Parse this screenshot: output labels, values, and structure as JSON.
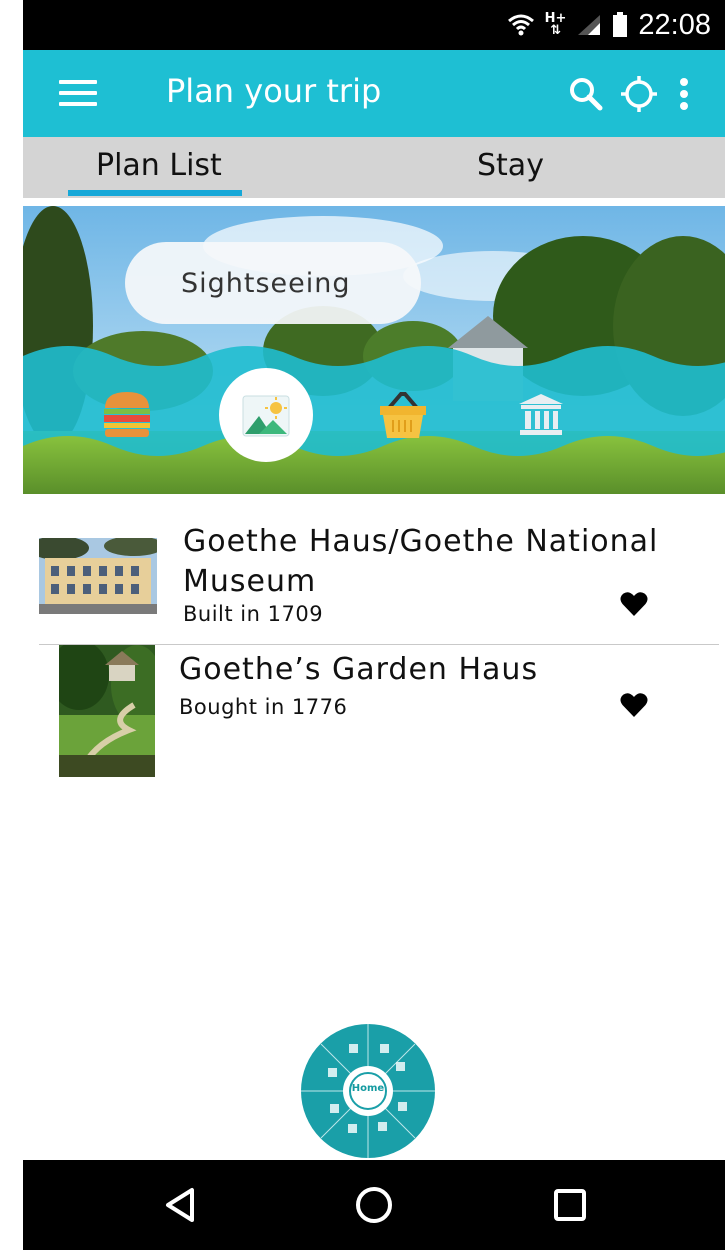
{
  "status_bar": {
    "time": "22:08",
    "network_type": "H+",
    "icons": [
      "wifi-icon",
      "signal-icon",
      "battery-icon"
    ]
  },
  "app_bar": {
    "title": "Plan your trip",
    "icons": [
      "menu-icon",
      "search-icon",
      "location-crosshair-icon",
      "more-vert-icon"
    ],
    "color": "#1ebfd3"
  },
  "tabs": [
    {
      "label": "Plan List",
      "active": true
    },
    {
      "label": "Stay",
      "active": false
    }
  ],
  "banner": {
    "selected_category": "Sightseeing",
    "categories": [
      {
        "icon": "burger-icon",
        "selected": false
      },
      {
        "icon": "landscape-picture-icon",
        "selected": true
      },
      {
        "icon": "shopping-basket-icon",
        "selected": false
      },
      {
        "icon": "museum-building-icon",
        "selected": false
      }
    ]
  },
  "places": [
    {
      "title": "Goethe Haus/Goethe National Museum",
      "subtitle": "Built in 1709",
      "favorite": true
    },
    {
      "title": "Goethe’s Garden Haus",
      "subtitle": "Bought in 1776",
      "favorite": true
    }
  ],
  "radial_menu": {
    "center_label": "Home"
  },
  "nav_bar": {
    "icons": [
      "back-triangle-icon",
      "home-circle-icon",
      "recents-square-icon"
    ]
  }
}
